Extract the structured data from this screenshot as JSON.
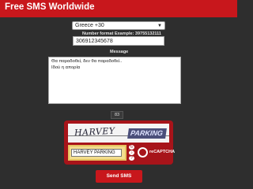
{
  "header": {
    "title": "Free SMS Worldwide"
  },
  "form": {
    "country_selected": "Greece +30",
    "number_format_label": "Number format Example: 39755132111",
    "phone_value": "306912345678",
    "message_label": "Message",
    "message_lines": [
      "Θα παραδοθεί, δεν θα παραδοθεί..",
      "Ιδού η απορία"
    ],
    "char_count": "83"
  },
  "captcha": {
    "word1": "HARVEY",
    "word2": "PARKING",
    "input_value": "HARVEY PARKING",
    "refresh_icon": "refresh-icon",
    "audio_icon": "audio-icon",
    "help_icon": "help-icon",
    "logo_text": "reCAPTCHA"
  },
  "send_button": {
    "label": "Send SMS"
  },
  "colors": {
    "header": "#c8171c",
    "background": "#2e2e2e",
    "captcha_frame": "#a7141a"
  }
}
